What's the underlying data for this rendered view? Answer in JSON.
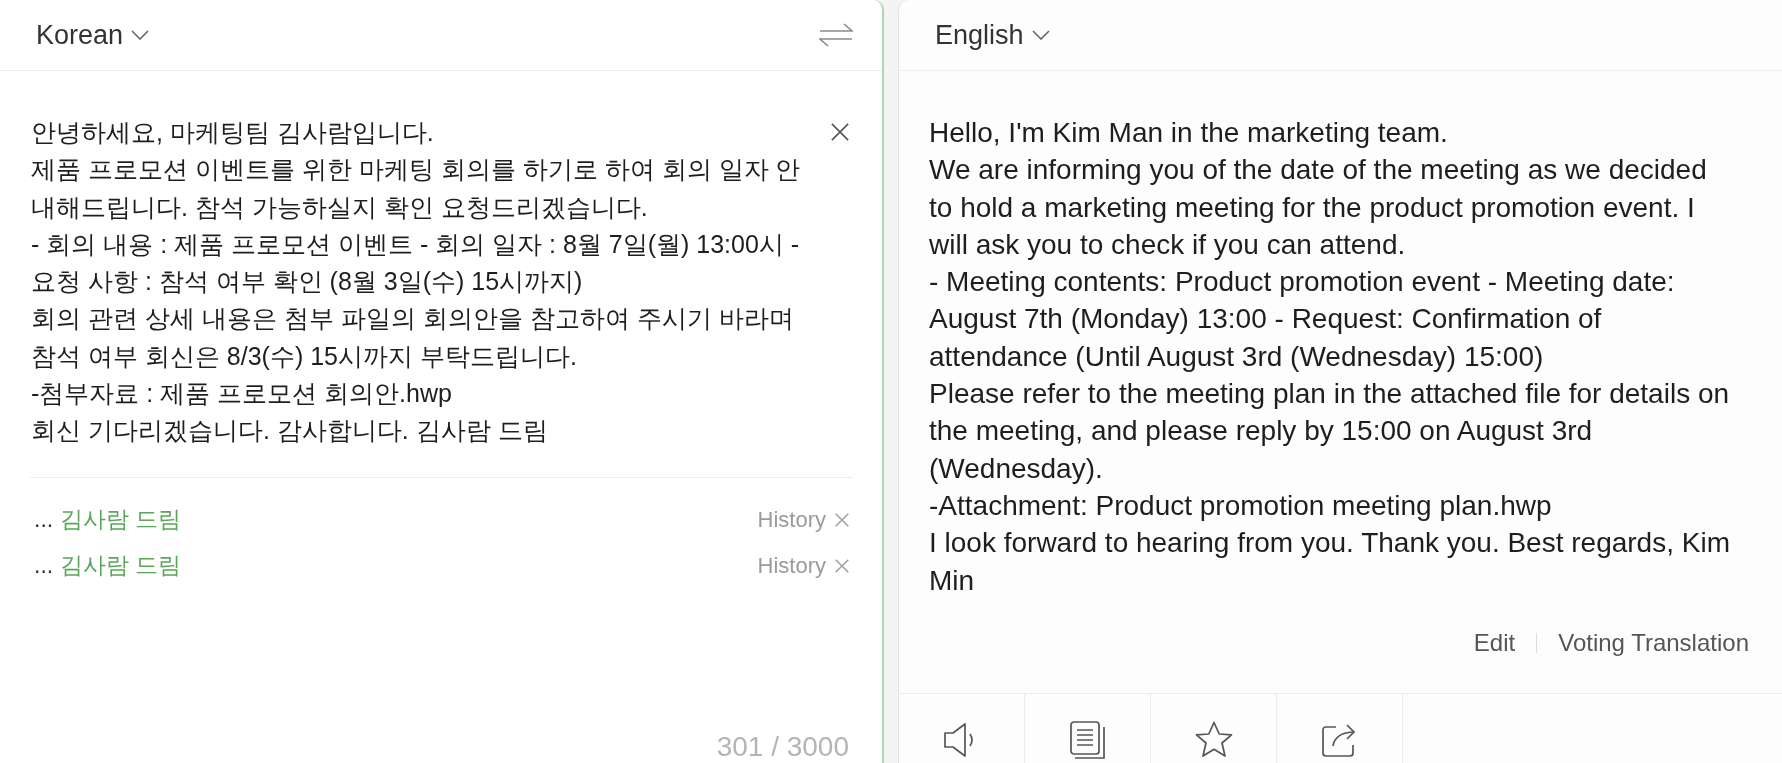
{
  "source": {
    "language": "Korean",
    "text_lines": [
      "안녕하세요, 마케팅팀 김사람입니다.",
      "제품 프로모션 이벤트를 위한 마케팅 회의를 하기로 하여 회의 일자 안",
      "내해드립니다. 참석 가능하실지 확인 요청드리겠습니다.",
      "- 회의 내용 : 제품 프로모션 이벤트 - 회의 일자 : 8월 7일(월) 13:00시 -",
      "요청 사항 : 참석 여부 확인 (8월 3일(수) 15시까지)",
      "회의 관련 상세 내용은 첨부 파일의 회의안을 참고하여 주시기 바라며",
      "참석 여부 회신은 8/3(수) 15시까지 부탁드립니다.",
      "-첨부자료 : 제품 프로모션 회의안.hwp",
      "회신 기다리겠습니다. 감사합니다. 김사람 드림"
    ],
    "history": [
      {
        "prefix": "...",
        "text": "김사람 드림",
        "label": "History"
      },
      {
        "prefix": "...",
        "text": "김사람 드림",
        "label": "History"
      }
    ],
    "char_count": "301 / 3000"
  },
  "target": {
    "language": "English",
    "text_lines": [
      "Hello, I'm Kim Man in the marketing team.",
      "We are informing you of the date of the meeting as we decided",
      "to hold a marketing meeting for the product promotion event. I",
      "will ask you to check if you can attend.",
      "- Meeting contents: Product promotion event - Meeting date:",
      "August 7th (Monday) 13:00 - Request: Confirmation of",
      "attendance (Until August 3rd (Wednesday) 15:00)",
      "Please refer to the meeting plan in the attached file for details on",
      "the meeting, and please reply by 15:00 on August 3rd",
      "(Wednesday).",
      "-Attachment: Product promotion meeting plan.hwp",
      "I look forward to hearing from you. Thank you. Best regards, Kim",
      "Min"
    ],
    "actions": [
      "Edit",
      "Voting Translation"
    ]
  },
  "toolbar": [
    {
      "kind": "listen"
    },
    {
      "kind": "copy"
    },
    {
      "kind": "favorite"
    },
    {
      "kind": "share"
    }
  ]
}
